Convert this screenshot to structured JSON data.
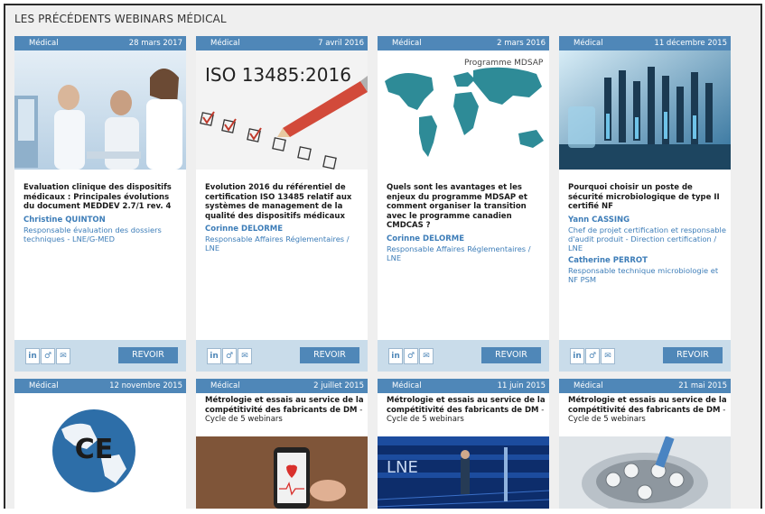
{
  "section_title": "LES PRÉCÉDENTS WEBINARS MÉDICAL",
  "revoir_label": "REVOIR",
  "social": [
    "in",
    "♂",
    "✉"
  ],
  "row1": [
    {
      "category": "Médical",
      "date": "28 mars 2017",
      "title": "Evaluation clinique des dispositifs médicaux : Principales évolutions du document MEDDEV 2.7/1 rev. 4",
      "speakers": [
        {
          "name": "Christine QUINTON",
          "role": "Responsable évaluation des dossiers techniques - LNE/G-MED"
        }
      ]
    },
    {
      "category": "Médical",
      "date": "7 avril 2016",
      "image_text": "ISO 13485:2016",
      "title": "Evolution 2016 du référentiel de certification ISO 13485 relatif aux systèmes de management de la qualité des dispositifs médicaux",
      "speakers": [
        {
          "name": "Corinne DELORME",
          "role": "Responsable Affaires Réglementaires / LNE"
        }
      ]
    },
    {
      "category": "Médical",
      "date": "2 mars 2016",
      "image_text": "Programme MDSAP",
      "title": "Quels sont les avantages et les enjeux du programme MDSAP et comment organiser la transition avec le programme canadien CMDCAS ?",
      "speakers": [
        {
          "name": "Corinne DELORME",
          "role": "Responsable Affaires Réglementaires / LNE"
        }
      ]
    },
    {
      "category": "Médical",
      "date": "11 décembre 2015",
      "title": "Pourquoi choisir un poste de sécurité microbiologique de type II certifié NF",
      "speakers": [
        {
          "name": "Yann CASSING",
          "role": "Chef de projet certification et responsable d'audit produit - Direction certification / LNE"
        },
        {
          "name": "Catherine PERROT",
          "role": "Responsable technique microbiologie et NF PSM"
        }
      ]
    }
  ],
  "row2": [
    {
      "category": "Médical",
      "date": "12 novembre 2015",
      "image_text": "CE",
      "title": "",
      "cycle": ""
    },
    {
      "category": "Médical",
      "date": "2 juillet 2015",
      "title": "Métrologie et essais au service de la compétitivité des fabricants de DM",
      "cycle": " - Cycle de 5 webinars"
    },
    {
      "category": "Médical",
      "date": "11 juin 2015",
      "image_text": "LNE",
      "title": "Métrologie et essais au service de la compétitivité des fabricants de DM",
      "cycle": " - Cycle de 5 webinars"
    },
    {
      "category": "Médical",
      "date": "21 mai 2015",
      "title": "Métrologie et essais au service de la compétitivité des fabricants de DM",
      "cycle": " - Cycle de 5 webinars"
    }
  ],
  "colors": {
    "accent": "#4f87b8",
    "footer": "#c9dcea",
    "link": "#3d7db8"
  },
  "icons": [
    "linkedin-icon",
    "share-icon",
    "mail-icon"
  ]
}
